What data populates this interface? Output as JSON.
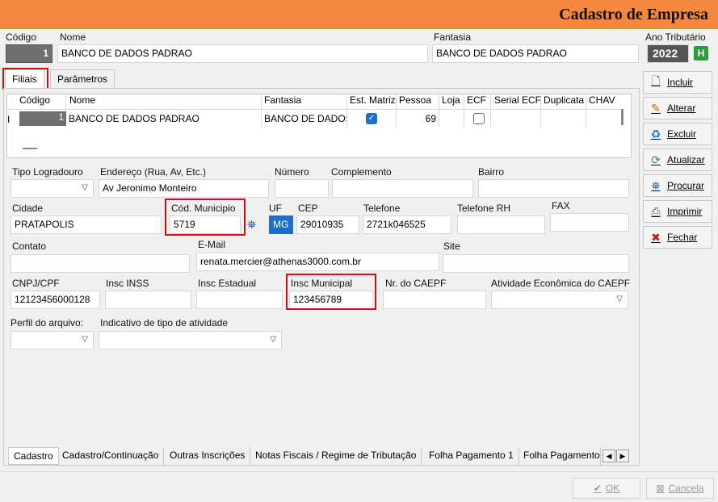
{
  "window": {
    "title": "Cadastro de Empresa"
  },
  "header": {
    "codigo_label": "Código",
    "codigo_value": "1",
    "nome_label": "Nome",
    "nome_value": "BANCO DE DADOS PADRAO",
    "fantasia_label": "Fantasia",
    "fantasia_value": "BANCO DE DADOS PADRAO",
    "ano_label": "Ano Tributário",
    "ano_value": "2022",
    "ano_btn": "H"
  },
  "tabs": [
    "Filiais",
    "Parâmetros"
  ],
  "grid": {
    "columns": [
      "Código",
      "Nome",
      "Fantasia",
      "Est. Matriz",
      "Pessoa",
      "Loja",
      "ECF",
      "Serial ECF",
      "Duplicata",
      "CHAV"
    ],
    "row": {
      "codigo": "1",
      "nome": "BANCO DE DADOS PADRAO",
      "fantasia": "BANCO DE DADOS",
      "pessoa": "69"
    }
  },
  "form": {
    "tipo_logradouro_label": "Tipo Logradouro",
    "endereco_label": "Endereço (Rua, Av,  Etc.)",
    "endereco_value": "Av Jeronimo Monteiro",
    "numero_label": "Número",
    "complemento_label": "Complemento",
    "bairro_label": "Bairro",
    "cidade_label": "Cidade",
    "cidade_value": "PRATAPOLIS",
    "cod_municipio_label": "Cód. Municipio",
    "cod_municipio_value": "5719",
    "uf_label": "UF",
    "uf_value": "MG",
    "cep_label": "CEP",
    "cep_value": "29010935",
    "telefone_label": "Telefone",
    "telefone_value": "2721k046525",
    "telefone_rh_label": "Telefone RH",
    "fax_label": "FAX",
    "contato_label": "Contato",
    "email_label": "E-Mail",
    "email_value": "renata.mercier@athenas3000.com.br",
    "site_label": "Site",
    "cnpj_label": "CNPJ/CPF",
    "cnpj_value": "12123456000128",
    "inss_label": "Insc INSS",
    "estadual_label": "Insc Estadual",
    "municipal_label": "Insc Municipal",
    "municipal_value": "123456789",
    "caepf_label": "Nr. do CAEPF",
    "atividade_label": "Atividade Econômica do CAEPF",
    "perfil_label": "Perfil do arquivo:",
    "indicativo_label": "Indicativo de tipo de atividade"
  },
  "bottom_tabs": [
    "Cadastro",
    "Cadastro/Continuação",
    "Outras Inscrições",
    "Notas Fiscais / Regime de Tributação",
    "Folha Pagamento 1",
    "Folha Pagamento"
  ],
  "side_buttons": [
    "Incluir",
    "Alterar",
    "Excluir",
    "Atualizar",
    "Procurar",
    "Imprimir",
    "Fechar"
  ],
  "footer": {
    "ok": "OK",
    "cancel": "Cancela"
  }
}
